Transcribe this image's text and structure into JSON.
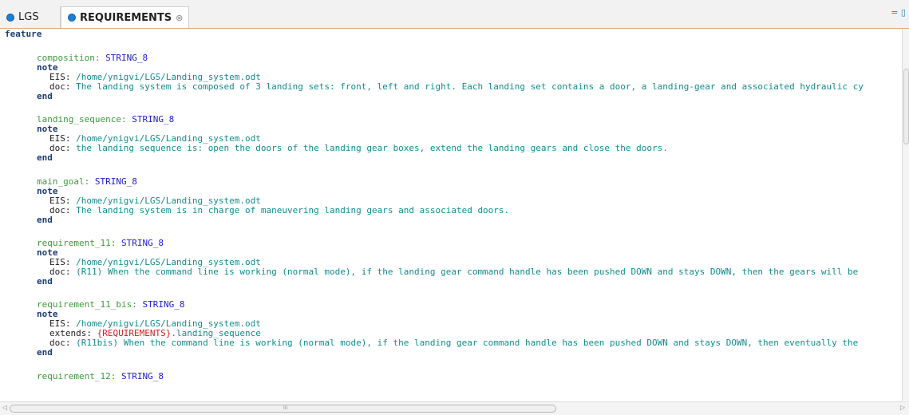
{
  "tabs": [
    {
      "label": "LGS"
    },
    {
      "label": "REQUIREMENTS",
      "close": "⊗"
    }
  ],
  "window_controls": "= ▯",
  "editor": {
    "header": "feature",
    "blocks": [
      {
        "name": "composition:",
        "type": "STRING_8",
        "note": "note",
        "eis_key": "EIS:",
        "eis_val": "/home/ynigvi/LGS/Landing_system.odt",
        "doc_key": "doc:",
        "doc_val": "The landing system is composed of 3 landing sets: front, left and right. Each landing set contains a door, a landing-gear and associated hydraulic cy",
        "end": "end"
      },
      {
        "name": "landing_sequence:",
        "type": "STRING_8",
        "note": "note",
        "eis_key": "EIS:",
        "eis_val": "/home/ynigvi/LGS/Landing_system.odt",
        "doc_key": "doc:",
        "doc_val": "the landing sequence is: open the doors of the landing gear boxes, extend the landing gears and close the doors.",
        "end": "end"
      },
      {
        "name": "main_goal:",
        "type": "STRING_8",
        "note": "note",
        "eis_key": "EIS:",
        "eis_val": "/home/ynigvi/LGS/Landing_system.odt",
        "doc_key": "doc:",
        "doc_val": "The landing system is in charge of maneuvering landing gears and associated doors.",
        "end": "end"
      },
      {
        "name": "requirement_11:",
        "type": "STRING_8",
        "note": "note",
        "eis_key": "EIS:",
        "eis_val": "/home/ynigvi/LGS/Landing_system.odt",
        "doc_key": "doc:",
        "doc_val": "(R11) When the command line is working (normal mode), if the landing gear command handle has been pushed DOWN and stays DOWN, then the gears will be",
        "end": "end"
      },
      {
        "name": "requirement_11_bis:",
        "type": "STRING_8",
        "note": "note",
        "eis_key": "EIS:",
        "eis_val": "/home/ynigvi/LGS/Landing_system.odt",
        "ext_key": "extends:",
        "ext_ref": "{REQUIREMENTS}",
        "ext_rest": ".landing_sequence",
        "doc_key": "doc:",
        "doc_val": "(R11bis) When the command line is working (normal mode), if the landing gear command handle has been pushed DOWN and stays DOWN, then eventually the",
        "end": "end"
      }
    ],
    "last": {
      "name": "requirement_12:",
      "type": "STRING_8"
    }
  },
  "scroll": {
    "grip": "III",
    "left_arrow": "◁",
    "right_arrow": "▷"
  }
}
